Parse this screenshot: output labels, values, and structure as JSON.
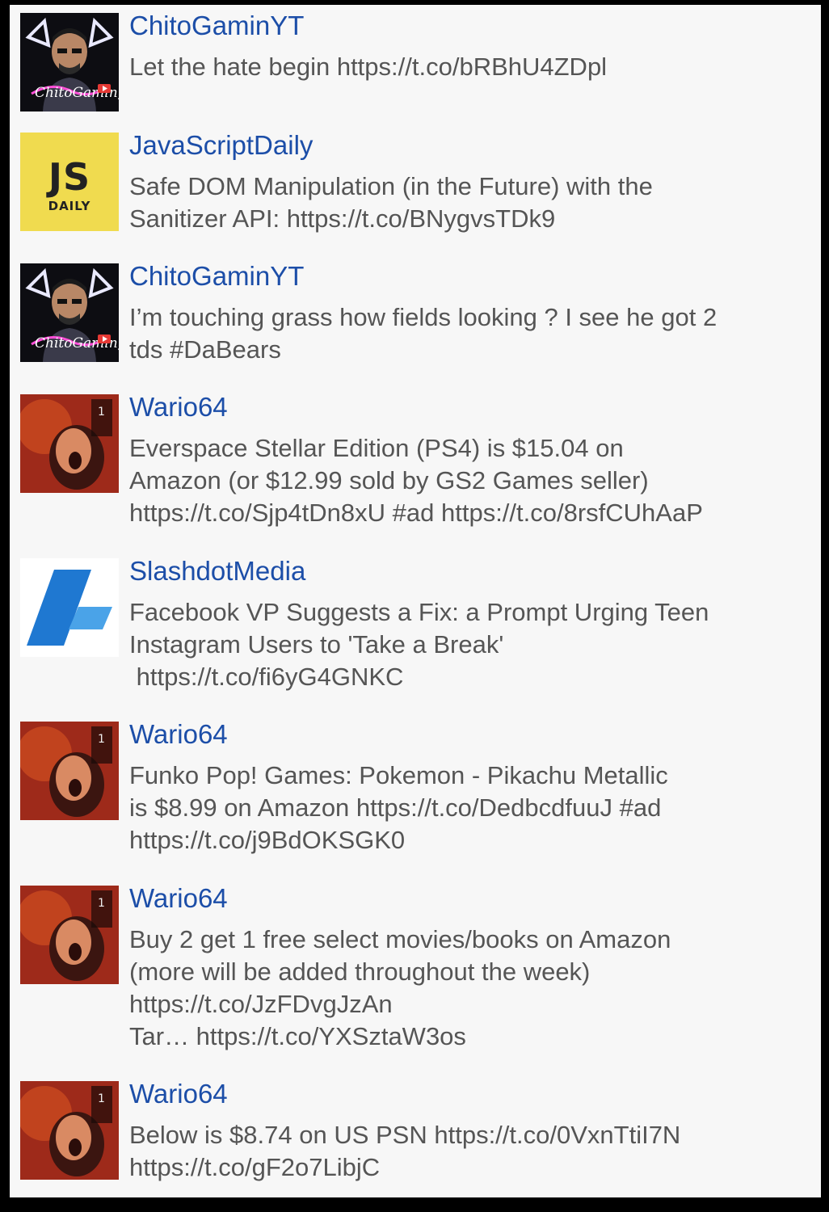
{
  "feed": {
    "tweets": [
      {
        "author": "ChitoGaminYT",
        "avatar_icon": "chitogaminyt-avatar-icon",
        "text": "Let the hate begin https://t.co/bRBhU4ZDpl"
      },
      {
        "author": "JavaScriptDaily",
        "avatar_icon": "javascriptdaily-logo-icon",
        "avatar_logo": "JS",
        "avatar_logo_sub": "DAILY",
        "text": "Safe DOM Manipulation (in the Future) with the\nSanitizer API: https://t.co/BNygvsTDk9"
      },
      {
        "author": "ChitoGaminYT",
        "avatar_icon": "chitogaminyt-avatar-icon",
        "text": "I’m touching grass how fields looking ? I see he got 2\ntds #DaBears"
      },
      {
        "author": "Wario64",
        "avatar_icon": "wario64-avatar-icon",
        "text": "Everspace Stellar Edition (PS4) is $15.04 on\nAmazon (or $12.99 sold by GS2 Games seller)\nhttps://t.co/Sjp4tDn8xU #ad https://t.co/8rsfCUhAaP"
      },
      {
        "author": "SlashdotMedia",
        "avatar_icon": "slashdotmedia-logo-icon",
        "text": "Facebook VP Suggests a Fix: a Prompt Urging Teen\nInstagram Users to 'Take a Break'\n https://t.co/fi6yG4GNKC"
      },
      {
        "author": "Wario64",
        "avatar_icon": "wario64-avatar-icon",
        "text": "Funko Pop! Games: Pokemon - Pikachu Metallic\nis $8.99 on Amazon https://t.co/DedbcdfuuJ #ad\nhttps://t.co/j9BdOKSGK0"
      },
      {
        "author": "Wario64",
        "avatar_icon": "wario64-avatar-icon",
        "text": "Buy 2 get 1 free select movies/books on Amazon\n(more will be added throughout the week)\nhttps://t.co/JzFDvgJzAn\nTar… https://t.co/YXSztaW3os"
      },
      {
        "author": "Wario64",
        "avatar_icon": "wario64-avatar-icon",
        "text": "Below is $8.74 on US PSN https://t.co/0VxnTtiI7N\nhttps://t.co/gF2o7LibjC"
      }
    ]
  }
}
